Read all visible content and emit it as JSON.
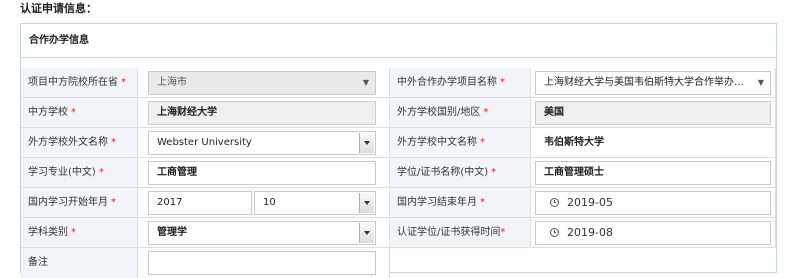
{
  "page_heading": "认证申请信息：",
  "section": {
    "title": "合作办学信息"
  },
  "required_mark": "*",
  "rows": {
    "province": {
      "label": "项目中方院校所在省",
      "value": "上海市"
    },
    "project_name": {
      "label": "中外合作办学项目名称",
      "value": "上海财经大学与美国韦伯斯特大学合作举办工商管理硕士学位教育项目"
    },
    "cn_school": {
      "label": "中方学校",
      "value": "上海财经大学"
    },
    "foreign_country": {
      "label": "外方学校国别/地区",
      "value": "美国"
    },
    "foreign_school_en": {
      "label": "外方学校外文名称",
      "value": "Webster University"
    },
    "foreign_school_cn": {
      "label": "外方学校中文名称",
      "value": "韦伯斯特大学"
    },
    "major": {
      "label": "学习专业(中文)",
      "value": "工商管理"
    },
    "degree_name": {
      "label": "学位/证书名称(中文)",
      "value": "工商管理硕士"
    },
    "study_start": {
      "label": "国内学习开始年月",
      "year": "2017",
      "month": "10"
    },
    "study_end": {
      "label": "国内学习结束年月",
      "value": "2019-05"
    },
    "subject": {
      "label": "学科类别",
      "value": "管理学"
    },
    "degree_time": {
      "label": "认证学位/证书获得时间",
      "value": "2019-08"
    },
    "remarks": {
      "label": "备注",
      "value": ""
    }
  }
}
